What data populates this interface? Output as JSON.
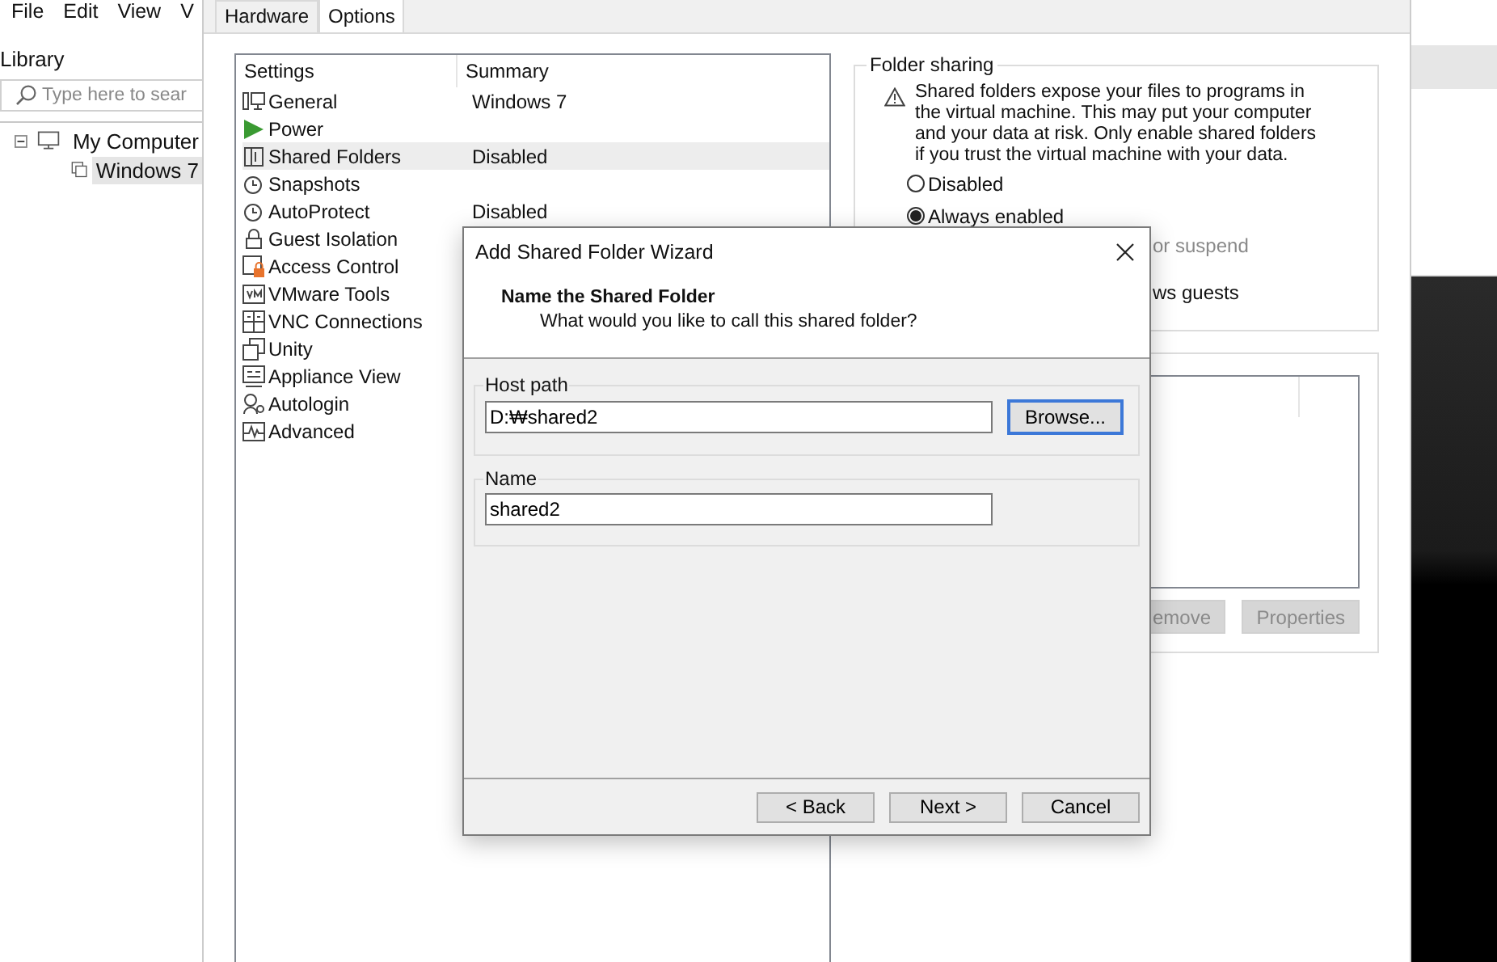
{
  "menu": [
    "File",
    "Edit",
    "View",
    "V"
  ],
  "library": {
    "title": "Library",
    "search": {
      "placeholder": "Type here to sear"
    },
    "tree": [
      {
        "label": "My Computer",
        "expanded": true,
        "children": [
          {
            "label": "Windows 7",
            "selected": true
          }
        ]
      }
    ]
  },
  "settings_window": {
    "tabs": [
      {
        "label": "Hardware",
        "selected": false
      },
      {
        "label": "Options",
        "selected": true
      }
    ],
    "table": {
      "columns": [
        "Settings",
        "Summary"
      ],
      "rows": [
        {
          "setting": "General",
          "summary": "Windows 7",
          "selected": false
        },
        {
          "setting": "Power",
          "selected": false
        },
        {
          "setting": "Shared Folders",
          "summary": "Disabled",
          "selected": true
        },
        {
          "setting": "Snapshots",
          "selected": false
        },
        {
          "setting": "AutoProtect",
          "summary": "Disabled",
          "selected": false
        },
        {
          "setting": "Guest Isolation",
          "selected": false
        },
        {
          "setting": "Access Control",
          "selected": false
        },
        {
          "setting": "VMware Tools",
          "selected": false
        },
        {
          "setting": "VNC Connections",
          "selected": false
        },
        {
          "setting": "Unity",
          "selected": false
        },
        {
          "setting": "Appliance View",
          "selected": false
        },
        {
          "setting": "Autologin",
          "selected": false
        },
        {
          "setting": "Advanced",
          "selected": false
        }
      ]
    },
    "folder_sharing": {
      "title": "Folder sharing",
      "warning": "Shared folders expose your files to programs in the virtual machine. This may put your computer and your data at risk. Only enable shared folders if you trust the virtual machine with your data.",
      "options": [
        {
          "label": "Disabled",
          "selected": false
        },
        {
          "label": "Always enabled",
          "selected": true
        }
      ],
      "partial_lines": [
        {
          "text": "or suspend",
          "disabled": true
        },
        {
          "text": "ws guests",
          "disabled": false
        }
      ]
    },
    "folders": {
      "buttons": [
        {
          "label": "emove",
          "disabled": true
        },
        {
          "label": "Properties",
          "disabled": true
        }
      ]
    }
  },
  "dialog": {
    "title": "Add Shared Folder Wizard",
    "heading": "Name the Shared Folder",
    "subheading": "What would you like to call this shared folder?",
    "host_path": {
      "label": "Host path",
      "value": "D:₩shared2",
      "button": "Browse..."
    },
    "name": {
      "label": "Name",
      "value": "shared2"
    },
    "buttons": [
      "< Back",
      "Next >",
      "Cancel"
    ]
  }
}
